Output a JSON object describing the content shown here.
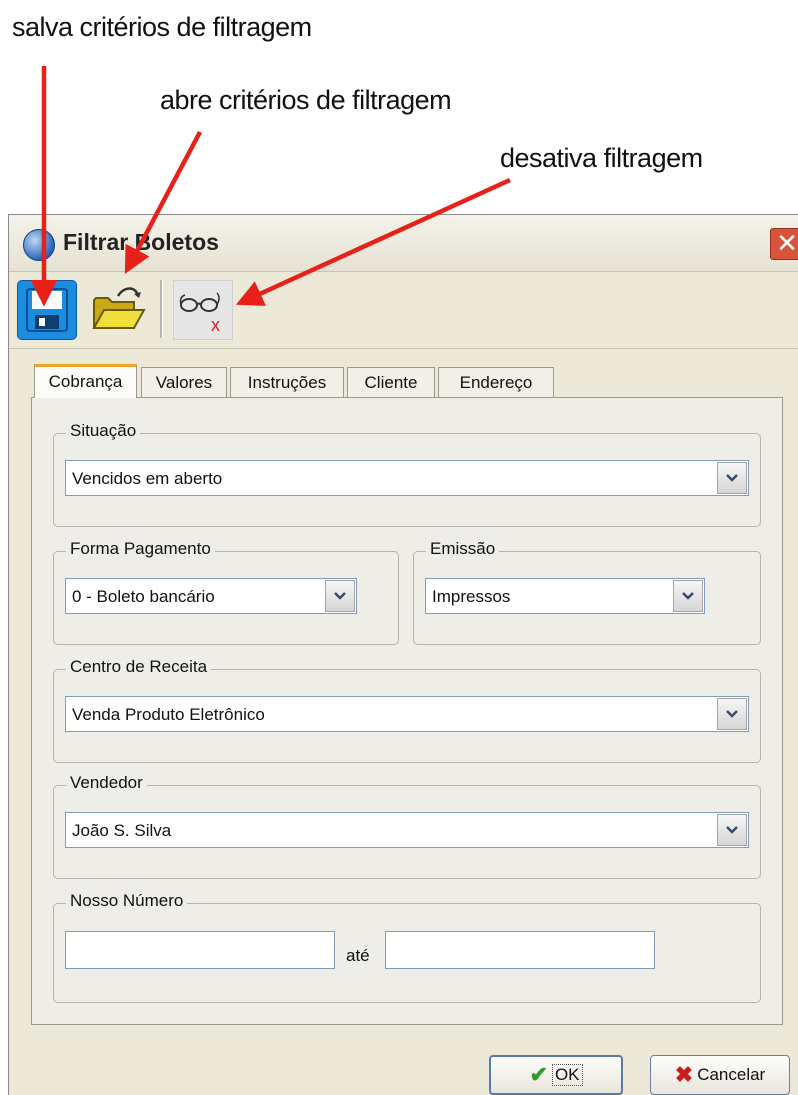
{
  "annotations": {
    "save": "salva critérios de filtragem",
    "open": "abre critérios de filtragem",
    "deactivate": "desativa filtragem",
    "arrow_color": "#e8201a"
  },
  "window": {
    "title": "Filtrar Boletos",
    "close_glyph": "✕"
  },
  "toolbar": {
    "save_icon": "floppy-disk-icon",
    "open_icon": "open-folder-icon",
    "deactivate_icon": "glasses-x-icon",
    "deactivate_x": "x"
  },
  "tabs": [
    "Cobrança",
    "Valores",
    "Instruções",
    "Cliente",
    "Endereço"
  ],
  "form": {
    "situacao": {
      "label": "Situação",
      "value": "Vencidos em aberto"
    },
    "forma_pagamento": {
      "label": "Forma Pagamento",
      "value": "0 - Boleto bancário"
    },
    "emissao": {
      "label": "Emissão",
      "value": "Impressos"
    },
    "centro_receita": {
      "label": "Centro de Receita",
      "value": "Venda Produto Eletrônico"
    },
    "vendedor": {
      "label": "Vendedor",
      "value": "João S. Silva"
    },
    "nosso_numero": {
      "label": "Nosso Número",
      "from": "",
      "to_label": "até",
      "to": ""
    }
  },
  "buttons": {
    "ok": "OK",
    "cancel": "Cancelar"
  },
  "colors": {
    "accent_tab": "#f0a32a",
    "ok_check": "#2f9a2a",
    "cancel_x": "#c81e1e"
  }
}
